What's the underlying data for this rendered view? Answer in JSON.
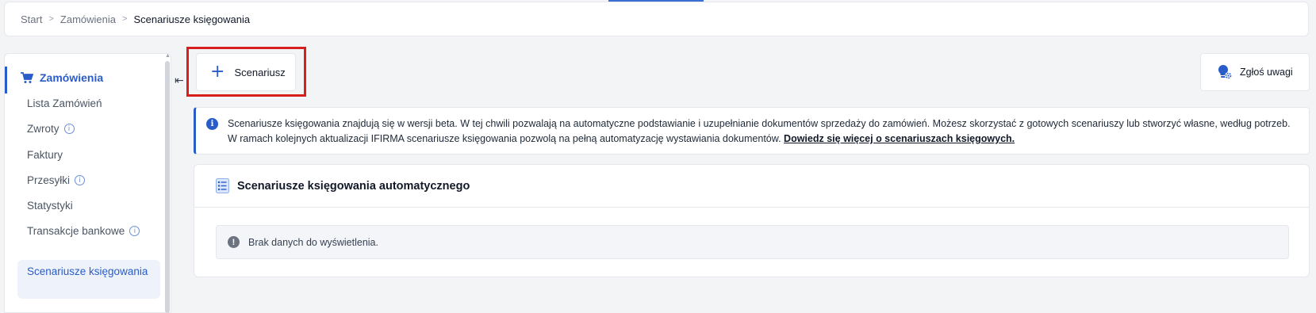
{
  "breadcrumb": {
    "items": [
      "Start",
      "Zamówienia"
    ],
    "current": "Scenariusze księgowania"
  },
  "sidebar": {
    "section_title": "Zamówienia",
    "section_icon": "cart-icon",
    "items": [
      {
        "label": "Lista Zamówień",
        "info": false
      },
      {
        "label": "Zwroty",
        "info": true
      },
      {
        "label": "Faktury",
        "info": false
      },
      {
        "label": "Przesyłki",
        "info": true
      },
      {
        "label": "Statystyki",
        "info": false
      },
      {
        "label": "Transakcje bankowe",
        "info": true
      }
    ],
    "selected_item": "Scenariusze księgowania"
  },
  "toolbar": {
    "add_label": "Scenariusz",
    "feedback_label": "Zgłoś uwagi"
  },
  "info": {
    "text": "Scenariusze księgowania znajdują się w wersji beta. W tej chwili pozwalają na automatyczne podstawianie i uzupełnianie dokumentów sprzedaży do zamówień. Możesz skorzystać z gotowych scenariuszy lub stworzyć własne, według potrzeb. W ramach kolejnych aktualizacji IFIRMA scenariusze księgowania pozwolą na pełną automatyzację wystawiania dokumentów.",
    "link_text": "Dowiedz się więcej o scenariuszach księgowych."
  },
  "panel": {
    "title": "Scenariusze księgowania automatycznego",
    "empty_message": "Brak danych do wyświetlenia."
  },
  "colors": {
    "accent": "#2a5cc9",
    "highlight_outline": "#d91e1e"
  }
}
